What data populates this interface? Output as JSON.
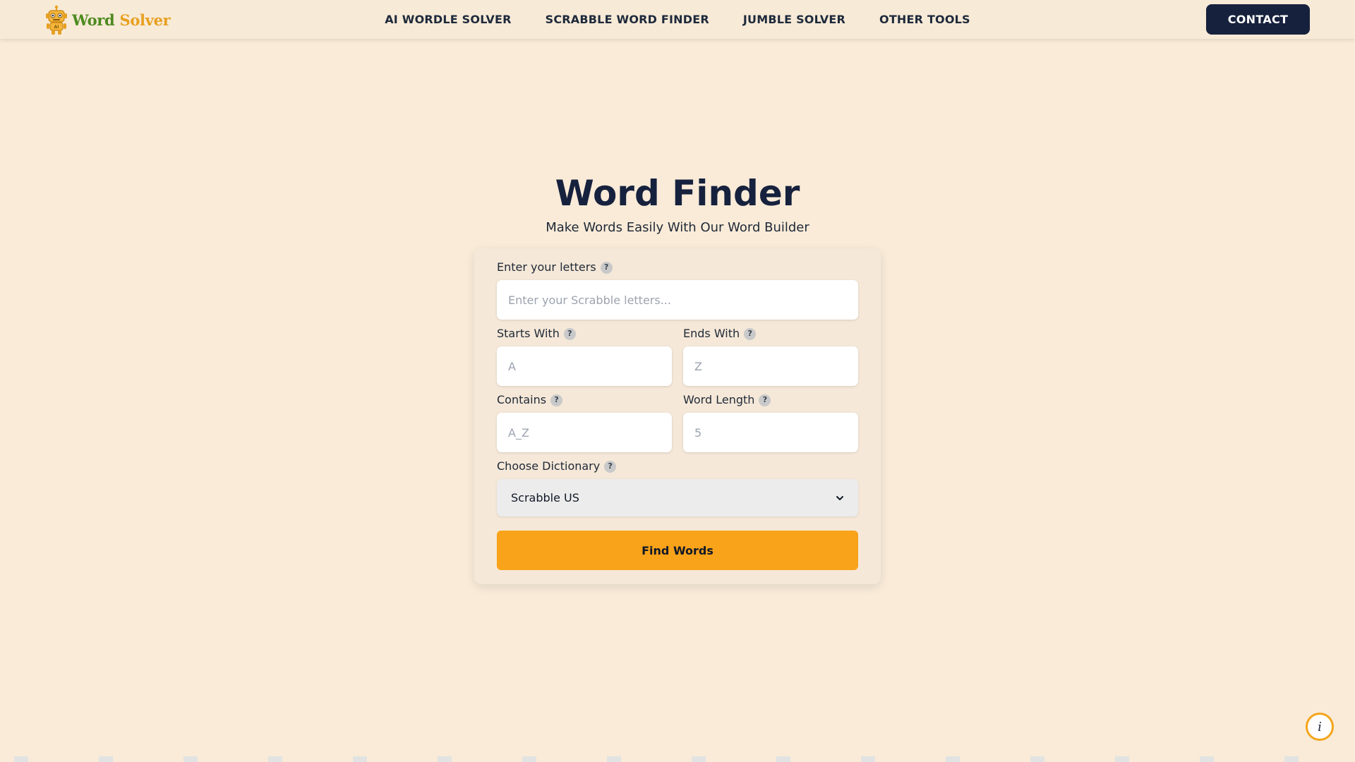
{
  "brand": {
    "name_part1": "Word",
    "name_part2": "Solver",
    "logo_icon": "robot-icon"
  },
  "nav": {
    "links": [
      {
        "label": "AI WORDLE SOLVER"
      },
      {
        "label": "SCRABBLE WORD FINDER"
      },
      {
        "label": "JUMBLE SOLVER"
      },
      {
        "label": "OTHER TOOLS"
      }
    ],
    "contact_label": "CONTACT"
  },
  "hero": {
    "title": "Word Finder",
    "subtitle": "Make Words Easily With Our Word Builder"
  },
  "form": {
    "letters": {
      "label": "Enter your letters",
      "placeholder": "Enter your Scrabble letters...",
      "value": ""
    },
    "starts_with": {
      "label": "Starts With",
      "placeholder": "A",
      "value": ""
    },
    "ends_with": {
      "label": "Ends With",
      "placeholder": "Z",
      "value": ""
    },
    "contains": {
      "label": "Contains",
      "placeholder": "A_Z",
      "value": ""
    },
    "word_length": {
      "label": "Word Length",
      "placeholder": "5",
      "value": ""
    },
    "dictionary": {
      "label": "Choose Dictionary",
      "selected": "Scrabble US"
    },
    "help_glyph": "?",
    "submit_label": "Find Words"
  },
  "info_button": {
    "glyph": "i",
    "icon": "info-icon"
  },
  "colors": {
    "page_bg": "#f9ebd8",
    "nav_bg": "#f7ead7",
    "brand_dark": "#16213d",
    "accent_orange": "#f9a31a",
    "logo_green": "#4d8a1f",
    "logo_gold": "#e8a020"
  }
}
